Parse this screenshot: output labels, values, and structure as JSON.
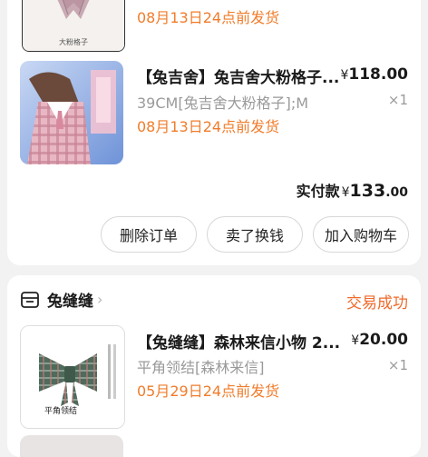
{
  "order1": {
    "prev_item": {
      "ship_text": "08月13日24点前发货",
      "image_label": "大粉格子"
    },
    "item": {
      "title": "【兔吉舍】兔吉舍大粉格子...",
      "currency": "¥",
      "price": "118.00",
      "spec": "39CM[兔吉舍大粉格子];M",
      "qty": "×1",
      "ship_text": "08月13日24点前发货"
    },
    "total_label": "实付款",
    "total_currency": "¥",
    "total_amount": "133",
    "total_decimal": ".00",
    "buttons": {
      "delete": "删除订单",
      "resell": "卖了换钱",
      "add_cart": "加入购物车"
    }
  },
  "order2": {
    "shop_name": "兔缝缝",
    "status": "交易成功",
    "item": {
      "title": "【兔缝缝】森林来信小物 2...",
      "currency": "¥",
      "price": "20.00",
      "spec": "平角领结[森林来信]",
      "qty": "×1",
      "ship_text": "05月29日24点前发货",
      "image_label": "平角领结"
    }
  },
  "colors": {
    "accent_orange": "#f07c2b",
    "status_orange": "#f06a2a",
    "background": "#f2f2f2"
  }
}
